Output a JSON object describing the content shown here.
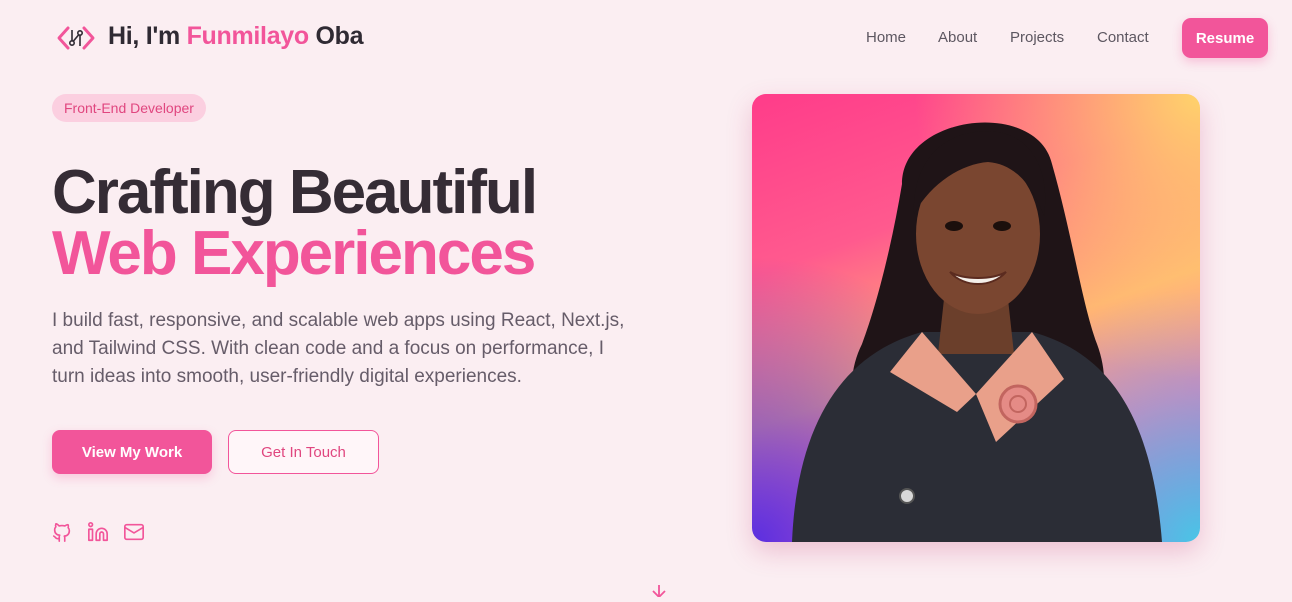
{
  "header": {
    "brand_prefix": "Hi, I'm ",
    "brand_name_accent": "Funmilayo",
    "brand_name_rest": " Oba",
    "nav": [
      "Home",
      "About",
      "Projects",
      "Contact"
    ],
    "resume_label": "Resume"
  },
  "hero": {
    "badge": "Front-End Developer",
    "headline_line1": "Crafting Beautiful",
    "headline_line2": "Web Experiences",
    "description": "I build fast, responsive, and scalable web apps using React, Next.js, and Tailwind CSS. With clean code and a focus on performance, I turn ideas into smooth, user-friendly digital experiences.",
    "primary_button": "View My Work",
    "secondary_button": "Get In Touch",
    "social_icons": [
      "github-icon",
      "linkedin-icon",
      "mail-icon"
    ]
  },
  "colors": {
    "accent": "#f2559a",
    "background": "#fbeef2",
    "heading": "#352c35",
    "body_text": "#665c69"
  }
}
